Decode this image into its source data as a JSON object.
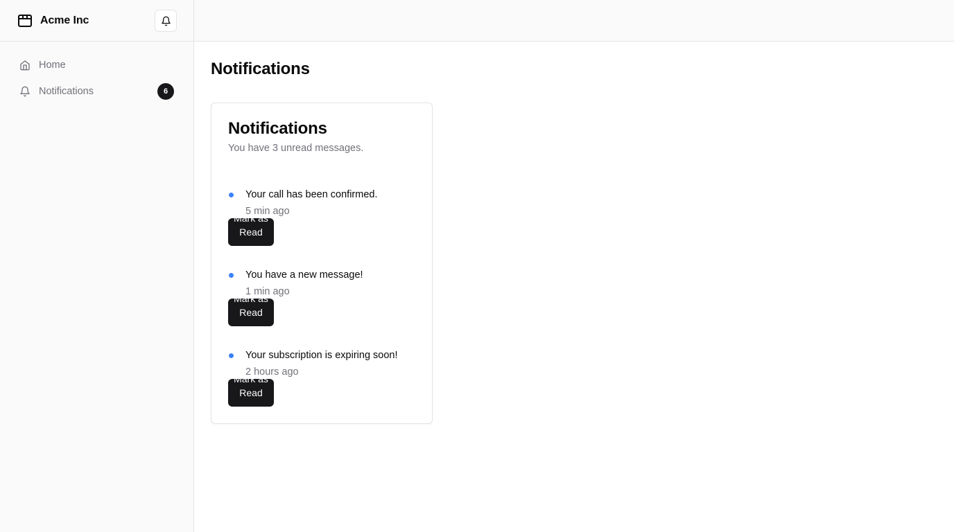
{
  "sidebar": {
    "brand": "Acme Inc",
    "nav": [
      {
        "label": "Home",
        "icon": "home-icon"
      },
      {
        "label": "Notifications",
        "icon": "bell-icon",
        "badge": "6"
      }
    ]
  },
  "main": {
    "page_title": "Notifications",
    "card": {
      "title": "Notifications",
      "description": "You have 3 unread messages.",
      "items": [
        {
          "message": "Your call has been confirmed.",
          "time": "5 min ago",
          "action": "Mark as Read"
        },
        {
          "message": "You have a new message!",
          "time": "1 min ago",
          "action": "Mark as Read"
        },
        {
          "message": "Your subscription is expiring soon!",
          "time": "2 hours ago",
          "action": "Mark as Read"
        }
      ]
    }
  },
  "colors": {
    "accent_dot": "#3b82f6",
    "primary": "#18181b",
    "muted_text": "#71717a",
    "border": "#e4e4e7",
    "sidebar_bg": "#fafafa"
  }
}
